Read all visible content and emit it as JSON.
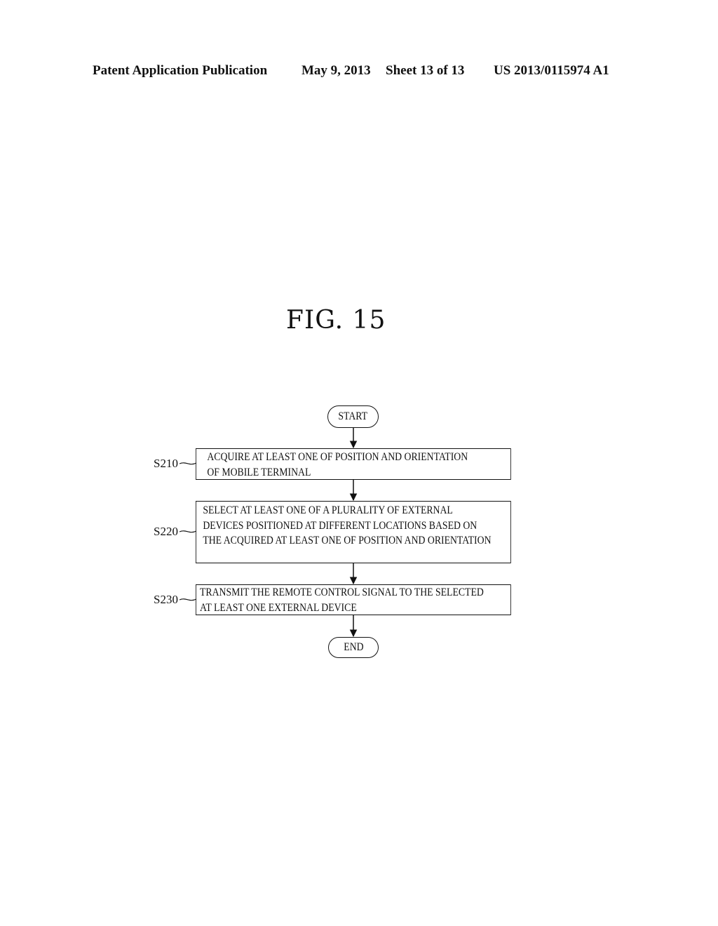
{
  "header": {
    "publication": "Patent Application Publication",
    "date": "May 9, 2013",
    "sheet": "Sheet 13 of 13",
    "number": "US 2013/0115974 A1"
  },
  "figure": {
    "title": "FIG.  15"
  },
  "flowchart": {
    "start": "START",
    "end": "END",
    "steps": [
      {
        "id": "S210",
        "lines": [
          "ACQUIRE AT LEAST ONE OF POSITION AND ORIENTATION",
          "OF MOBILE TERMINAL"
        ]
      },
      {
        "id": "S220",
        "lines": [
          "SELECT AT LEAST ONE OF A PLURALITY OF EXTERNAL",
          "DEVICES POSITIONED AT DIFFERENT LOCATIONS BASED ON",
          "THE ACQUIRED AT LEAST ONE OF POSITION AND ORIENTATION"
        ]
      },
      {
        "id": "S230",
        "lines": [
          "TRANSMIT THE REMOTE CONTROL SIGNAL TO THE SELECTED",
          "AT LEAST ONE EXTERNAL DEVICE"
        ]
      }
    ]
  }
}
